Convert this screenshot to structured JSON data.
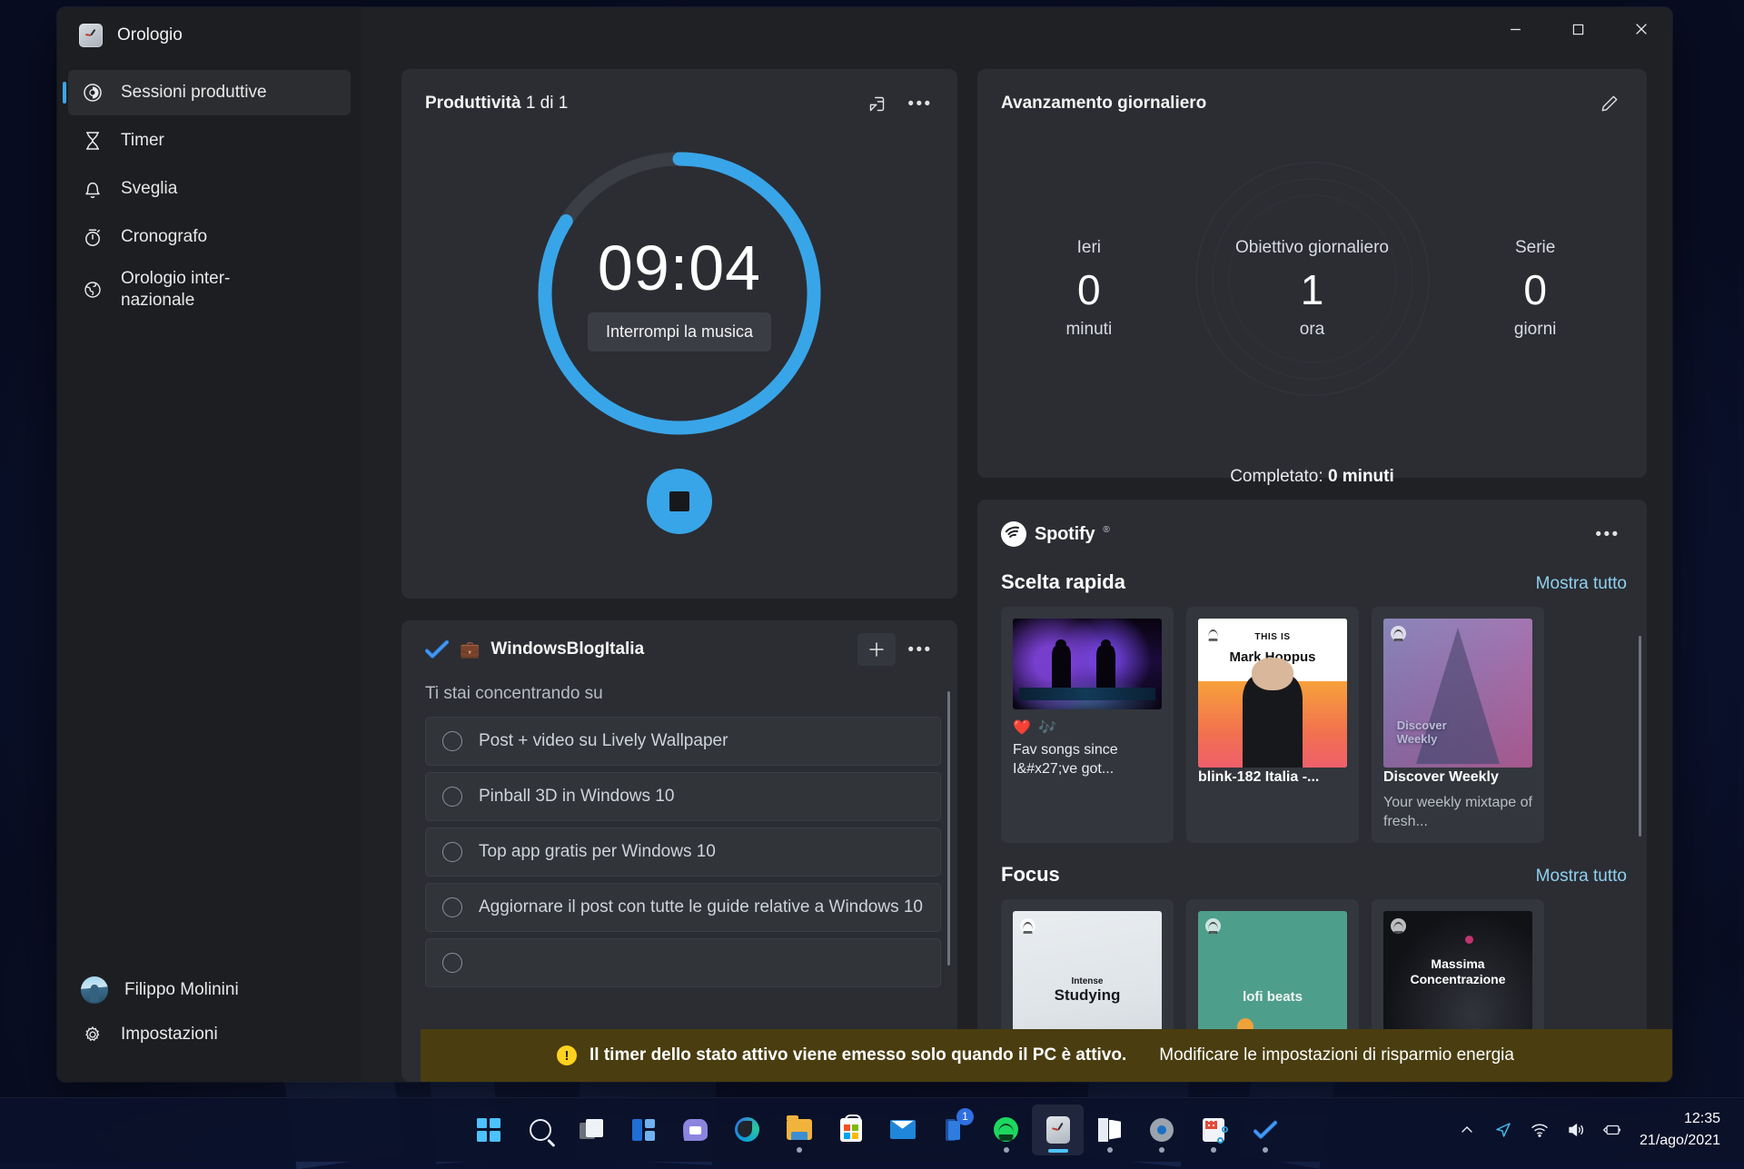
{
  "window": {
    "app_title": "Orologio",
    "app_icon": "clock-icon",
    "caption": {
      "minimize": "minimize-icon",
      "maximize": "maximize-icon",
      "close": "close-icon"
    }
  },
  "sidebar": {
    "items": [
      {
        "label": "Sessioni produttive",
        "icon": "focus-sessions-icon",
        "selected": true
      },
      {
        "label": "Timer",
        "icon": "hourglass-icon",
        "selected": false
      },
      {
        "label": "Sveglia",
        "icon": "bell-icon",
        "selected": false
      },
      {
        "label": "Cronografo",
        "icon": "stopwatch-icon",
        "selected": false
      },
      {
        "label": "Orologio inter-\nnazionale",
        "icon": "globe-icon",
        "selected": false
      }
    ],
    "account": {
      "name": "Filippo Molinini",
      "avatar": "user-avatar"
    },
    "settings": {
      "label": "Impostazioni",
      "icon": "gear-icon"
    }
  },
  "focus_timer": {
    "title_bold": "Produttività",
    "title_light": " 1 di 1",
    "compact_overlay_icon": "compact-overlay-icon",
    "more_icon": "more-options-icon",
    "time": "09:04",
    "pause_music_label": "Interrompi la musica",
    "stop_label": "stop-icon",
    "ring": {
      "progress_percent": 84,
      "track_color": "#3b3e45",
      "progress_color": "#38a5e8"
    }
  },
  "tasks": {
    "list_name": "WindowsBlogItalia",
    "list_emoji": "💼",
    "todo_icon": "microsoft-todo-icon",
    "add_icon": "add-task-icon",
    "more_icon": "more-options-icon",
    "subtitle": "Ti stai concentrando su",
    "items": [
      "Post + video su Lively Wallpaper",
      "Pinball 3D in Windows 10",
      "Top app gratis per Windows 10",
      "Aggiornare il post con tutte le guide relative a Windows 10"
    ]
  },
  "daily_progress": {
    "title": "Avanzamento giornaliero",
    "edit_icon": "edit-pencil-icon",
    "stats": [
      {
        "caption": "Ieri",
        "value": "0",
        "unit": "minuti"
      },
      {
        "caption": "Obiettivo giornaliero",
        "value": "1",
        "unit": "ora"
      },
      {
        "caption": "Serie",
        "value": "0",
        "unit": "giorni"
      }
    ],
    "completed_label": "Completato: ",
    "completed_value": "0 minuti"
  },
  "spotify": {
    "brand": "Spotify",
    "trademark": "®",
    "logo_icon": "spotify-logo-icon",
    "more_icon": "more-options-icon",
    "sections": [
      {
        "title": "Scelta rapida",
        "show_all": "Mostra tutto",
        "tiles": [
          {
            "name": "Fav songs since I&#x27;ve got...",
            "desc": "",
            "badges": "❤️ 🎶",
            "art": "dj",
            "art_text": ""
          },
          {
            "name": "blink-182 Italia -...",
            "desc": "",
            "badges": "",
            "art": "mark-hoppus",
            "art_text": "THIS IS Mark Hoppus"
          },
          {
            "name": "Discover Weekly",
            "desc": "Your weekly mixtape of fresh...",
            "badges": "",
            "art": "discover-weekly",
            "art_text": "Discover Weekly"
          }
        ]
      },
      {
        "title": "Focus",
        "show_all": "Mostra tutto",
        "tiles": [
          {
            "name": "",
            "desc": "",
            "badges": "",
            "art": "intense-studying",
            "art_text": "Intense Studying"
          },
          {
            "name": "",
            "desc": "",
            "badges": "",
            "art": "lofi-beats",
            "art_text": "lofi beats"
          },
          {
            "name": "",
            "desc": "",
            "badges": "",
            "art": "massima-concentrazione",
            "art_text": "Massima Concentrazione"
          }
        ]
      }
    ]
  },
  "toast": {
    "warning_glyph": "!",
    "message": "Il timer dello stato attivo viene emesso solo quando il PC è attivo.",
    "action": "Modificare le impostazioni di risparmio energia"
  },
  "taskbar": {
    "items": [
      {
        "name": "start-button",
        "icon": "windows-start-icon",
        "state": "none",
        "badge": ""
      },
      {
        "name": "search-button",
        "icon": "search-icon",
        "state": "none",
        "badge": ""
      },
      {
        "name": "task-view-button",
        "icon": "task-view-icon",
        "state": "none",
        "badge": ""
      },
      {
        "name": "widgets-button",
        "icon": "widgets-icon",
        "state": "none",
        "badge": ""
      },
      {
        "name": "chat-button",
        "icon": "chat-icon",
        "state": "none",
        "badge": ""
      },
      {
        "name": "edge-button",
        "icon": "microsoft-edge-icon",
        "state": "none",
        "badge": ""
      },
      {
        "name": "file-explorer-button",
        "icon": "file-explorer-icon",
        "state": "dot",
        "badge": ""
      },
      {
        "name": "microsoft-store-button",
        "icon": "microsoft-store-icon",
        "state": "none",
        "badge": ""
      },
      {
        "name": "mail-button",
        "icon": "mail-icon",
        "state": "none",
        "badge": ""
      },
      {
        "name": "phone-link-button",
        "icon": "phone-link-icon",
        "state": "none",
        "badge": "1"
      },
      {
        "name": "spotify-button",
        "icon": "spotify-icon",
        "state": "dot",
        "badge": ""
      },
      {
        "name": "clock-button",
        "icon": "clock-app-icon",
        "state": "bar",
        "badge": ""
      },
      {
        "name": "office-button",
        "icon": "office-icon",
        "state": "dot",
        "badge": ""
      },
      {
        "name": "settings-button",
        "icon": "settings-gear-icon",
        "state": "dot",
        "badge": ""
      },
      {
        "name": "snipping-tool-button",
        "icon": "snipping-tool-icon",
        "state": "dot",
        "badge": ""
      },
      {
        "name": "todo-button",
        "icon": "microsoft-todo-icon",
        "state": "dot",
        "badge": ""
      }
    ],
    "tray": [
      {
        "name": "show-hidden-icons-button",
        "icon": "chevron-up-icon"
      },
      {
        "name": "meet-now-button",
        "icon": "send-arrow-icon"
      },
      {
        "name": "network-button",
        "icon": "wifi-icon"
      },
      {
        "name": "volume-button",
        "icon": "speaker-icon"
      },
      {
        "name": "battery-button",
        "icon": "battery-charging-icon"
      }
    ],
    "clock": {
      "time": "12:35",
      "date": "21/ago/2021"
    }
  }
}
